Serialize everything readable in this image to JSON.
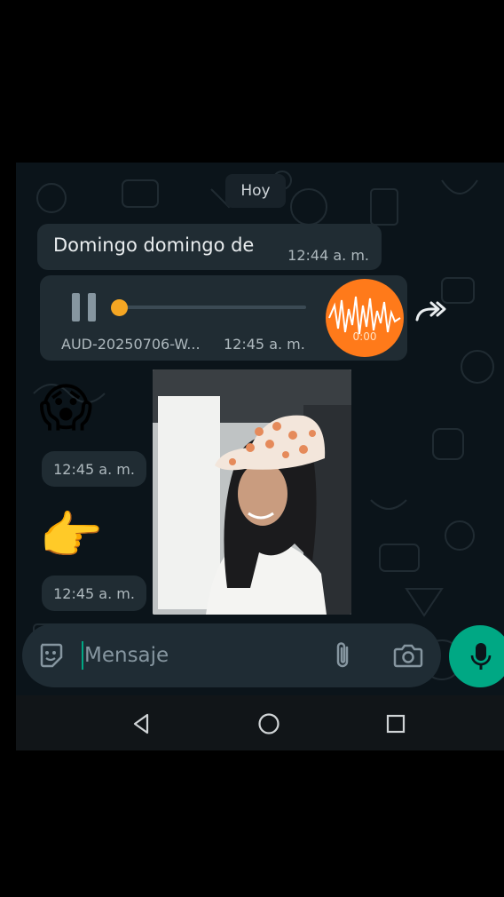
{
  "chat": {
    "date_label": "Hoy",
    "messages": [
      {
        "type": "text",
        "text": "Domingo domingo de",
        "time": "12:44 a. m."
      },
      {
        "type": "audio",
        "filename": "AUD-20250706-W...",
        "time": "12:45 a. m.",
        "duration": "0:00",
        "progress": 0.0
      },
      {
        "type": "emoji",
        "emoji": "😱",
        "time": "12:45 a. m."
      },
      {
        "type": "emoji",
        "emoji": "👉",
        "time": "12:45 a. m."
      },
      {
        "type": "video",
        "description_icon": "video-thumbnail"
      }
    ]
  },
  "composer": {
    "placeholder": "Mensaje",
    "icons": [
      "sticker-icon",
      "attach-icon",
      "camera-icon",
      "mic-icon"
    ]
  },
  "navigation": {
    "icons": [
      "back-icon",
      "home-icon",
      "recents-icon"
    ]
  },
  "colors": {
    "background": "#0b141a",
    "bubble": "#202c33",
    "accent": "#00a884",
    "audio_avatar": "#ff7a1a",
    "audio_knob": "#f5a623"
  }
}
